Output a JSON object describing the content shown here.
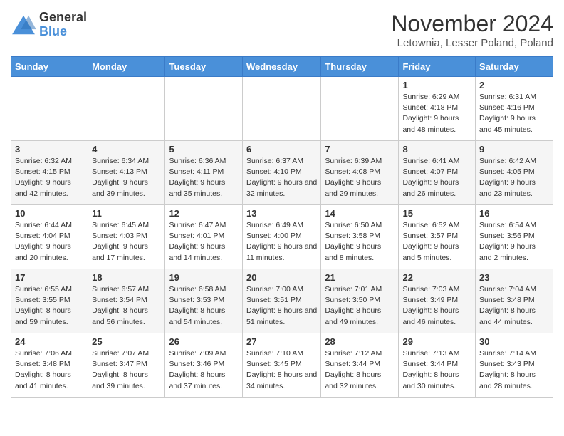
{
  "logo": {
    "line1": "General",
    "line2": "Blue"
  },
  "title": "November 2024",
  "subtitle": "Letownia, Lesser Poland, Poland",
  "days_of_week": [
    "Sunday",
    "Monday",
    "Tuesday",
    "Wednesday",
    "Thursday",
    "Friday",
    "Saturday"
  ],
  "weeks": [
    [
      {
        "day": "",
        "info": ""
      },
      {
        "day": "",
        "info": ""
      },
      {
        "day": "",
        "info": ""
      },
      {
        "day": "",
        "info": ""
      },
      {
        "day": "",
        "info": ""
      },
      {
        "day": "1",
        "info": "Sunrise: 6:29 AM\nSunset: 4:18 PM\nDaylight: 9 hours and 48 minutes."
      },
      {
        "day": "2",
        "info": "Sunrise: 6:31 AM\nSunset: 4:16 PM\nDaylight: 9 hours and 45 minutes."
      }
    ],
    [
      {
        "day": "3",
        "info": "Sunrise: 6:32 AM\nSunset: 4:15 PM\nDaylight: 9 hours and 42 minutes."
      },
      {
        "day": "4",
        "info": "Sunrise: 6:34 AM\nSunset: 4:13 PM\nDaylight: 9 hours and 39 minutes."
      },
      {
        "day": "5",
        "info": "Sunrise: 6:36 AM\nSunset: 4:11 PM\nDaylight: 9 hours and 35 minutes."
      },
      {
        "day": "6",
        "info": "Sunrise: 6:37 AM\nSunset: 4:10 PM\nDaylight: 9 hours and 32 minutes."
      },
      {
        "day": "7",
        "info": "Sunrise: 6:39 AM\nSunset: 4:08 PM\nDaylight: 9 hours and 29 minutes."
      },
      {
        "day": "8",
        "info": "Sunrise: 6:41 AM\nSunset: 4:07 PM\nDaylight: 9 hours and 26 minutes."
      },
      {
        "day": "9",
        "info": "Sunrise: 6:42 AM\nSunset: 4:05 PM\nDaylight: 9 hours and 23 minutes."
      }
    ],
    [
      {
        "day": "10",
        "info": "Sunrise: 6:44 AM\nSunset: 4:04 PM\nDaylight: 9 hours and 20 minutes."
      },
      {
        "day": "11",
        "info": "Sunrise: 6:45 AM\nSunset: 4:03 PM\nDaylight: 9 hours and 17 minutes."
      },
      {
        "day": "12",
        "info": "Sunrise: 6:47 AM\nSunset: 4:01 PM\nDaylight: 9 hours and 14 minutes."
      },
      {
        "day": "13",
        "info": "Sunrise: 6:49 AM\nSunset: 4:00 PM\nDaylight: 9 hours and 11 minutes."
      },
      {
        "day": "14",
        "info": "Sunrise: 6:50 AM\nSunset: 3:58 PM\nDaylight: 9 hours and 8 minutes."
      },
      {
        "day": "15",
        "info": "Sunrise: 6:52 AM\nSunset: 3:57 PM\nDaylight: 9 hours and 5 minutes."
      },
      {
        "day": "16",
        "info": "Sunrise: 6:54 AM\nSunset: 3:56 PM\nDaylight: 9 hours and 2 minutes."
      }
    ],
    [
      {
        "day": "17",
        "info": "Sunrise: 6:55 AM\nSunset: 3:55 PM\nDaylight: 8 hours and 59 minutes."
      },
      {
        "day": "18",
        "info": "Sunrise: 6:57 AM\nSunset: 3:54 PM\nDaylight: 8 hours and 56 minutes."
      },
      {
        "day": "19",
        "info": "Sunrise: 6:58 AM\nSunset: 3:53 PM\nDaylight: 8 hours and 54 minutes."
      },
      {
        "day": "20",
        "info": "Sunrise: 7:00 AM\nSunset: 3:51 PM\nDaylight: 8 hours and 51 minutes."
      },
      {
        "day": "21",
        "info": "Sunrise: 7:01 AM\nSunset: 3:50 PM\nDaylight: 8 hours and 49 minutes."
      },
      {
        "day": "22",
        "info": "Sunrise: 7:03 AM\nSunset: 3:49 PM\nDaylight: 8 hours and 46 minutes."
      },
      {
        "day": "23",
        "info": "Sunrise: 7:04 AM\nSunset: 3:48 PM\nDaylight: 8 hours and 44 minutes."
      }
    ],
    [
      {
        "day": "24",
        "info": "Sunrise: 7:06 AM\nSunset: 3:48 PM\nDaylight: 8 hours and 41 minutes."
      },
      {
        "day": "25",
        "info": "Sunrise: 7:07 AM\nSunset: 3:47 PM\nDaylight: 8 hours and 39 minutes."
      },
      {
        "day": "26",
        "info": "Sunrise: 7:09 AM\nSunset: 3:46 PM\nDaylight: 8 hours and 37 minutes."
      },
      {
        "day": "27",
        "info": "Sunrise: 7:10 AM\nSunset: 3:45 PM\nDaylight: 8 hours and 34 minutes."
      },
      {
        "day": "28",
        "info": "Sunrise: 7:12 AM\nSunset: 3:44 PM\nDaylight: 8 hours and 32 minutes."
      },
      {
        "day": "29",
        "info": "Sunrise: 7:13 AM\nSunset: 3:44 PM\nDaylight: 8 hours and 30 minutes."
      },
      {
        "day": "30",
        "info": "Sunrise: 7:14 AM\nSunset: 3:43 PM\nDaylight: 8 hours and 28 minutes."
      }
    ]
  ]
}
